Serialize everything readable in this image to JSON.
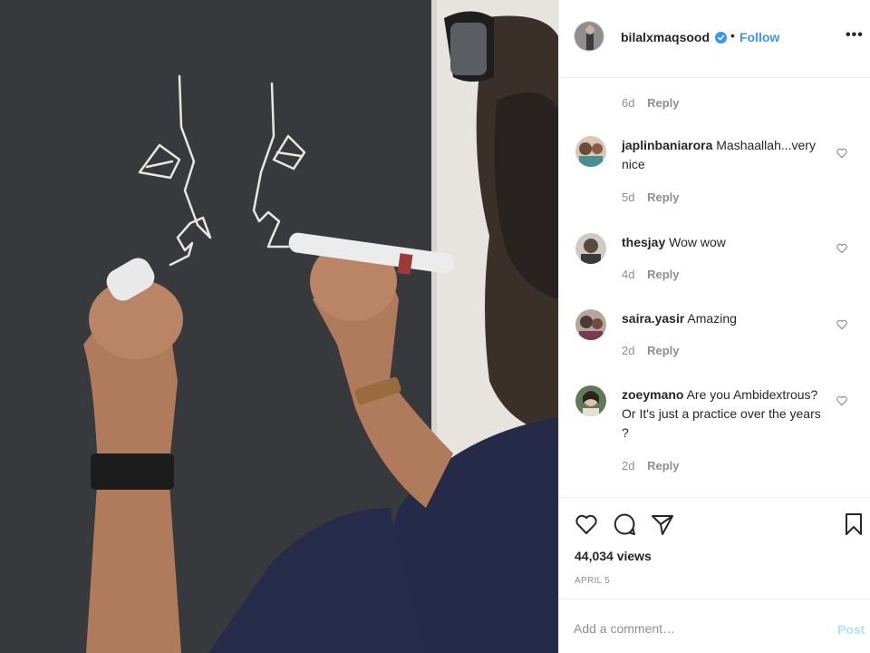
{
  "post": {
    "username": "bilalxmaqsood",
    "follow_label": "Follow",
    "separator": "•",
    "more_glyph": "•••",
    "verified": true
  },
  "first_comment_meta": {
    "time": "6d",
    "reply": "Reply"
  },
  "comments": [
    {
      "username": "japlinbaniarora",
      "text": "Mashaallah...very nice",
      "time": "5d",
      "reply": "Reply"
    },
    {
      "username": "thesjay",
      "text": "Wow wow",
      "time": "4d",
      "reply": "Reply"
    },
    {
      "username": "saira.yasir",
      "text": "Amazing",
      "time": "2d",
      "reply": "Reply"
    },
    {
      "username": "zoeymano",
      "text": "Are you Ambidextrous? Or It's just a practice over the years ?",
      "time": "2d",
      "reply": "Reply"
    }
  ],
  "stats": {
    "views": "44,034 views",
    "date": "APRIL 5"
  },
  "composer": {
    "placeholder": "Add a comment…",
    "post_label": "Post"
  },
  "icons": {
    "like": "heart-icon",
    "comment": "comment-bubble-icon",
    "share": "paper-plane-icon",
    "save": "bookmark-icon",
    "verified": "verified-badge-icon",
    "more": "more-options-icon"
  },
  "colors": {
    "accent": "#3897f0",
    "post_disabled": "#b2dffc",
    "text": "#262626",
    "muted": "#8e8e8e",
    "chalkboard": "#35363a"
  }
}
